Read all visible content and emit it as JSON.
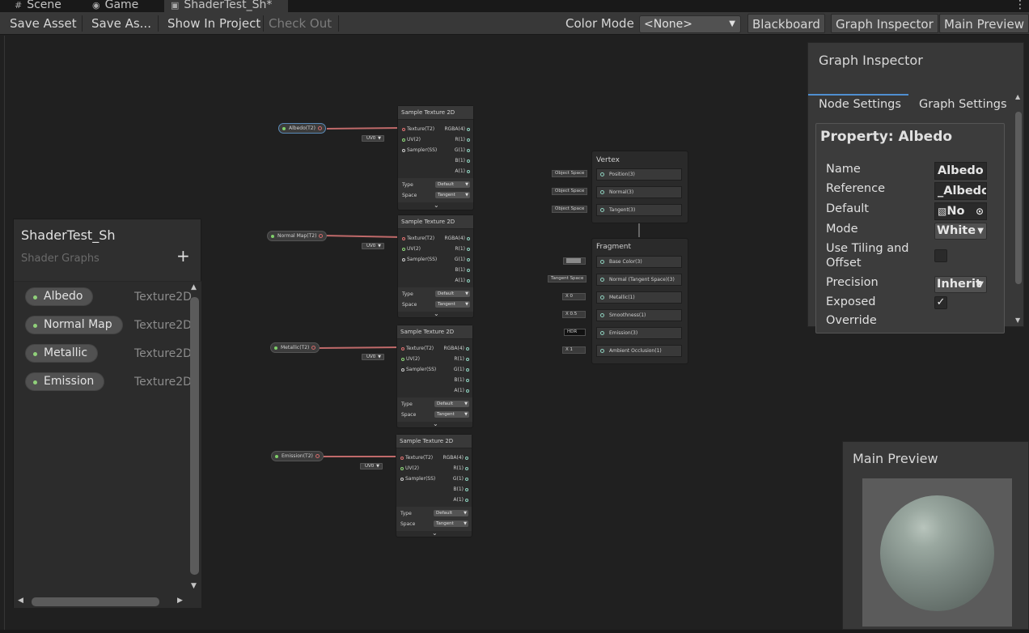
{
  "tabs": [
    {
      "label": "Scene",
      "icon": "grid-icon"
    },
    {
      "label": "Game",
      "icon": "gamepad-icon"
    },
    {
      "label": "ShaderTest_Sh*",
      "icon": "shader-graph-icon"
    }
  ],
  "more_icon": "⋮",
  "toolbar": {
    "save_asset": "Save Asset",
    "save_as": "Save As...",
    "show_in_project": "Show In Project",
    "check_out": "Check Out",
    "color_mode_label": "Color Mode",
    "color_mode_value": "<None>",
    "blackboard": "Blackboard",
    "graph_inspector": "Graph Inspector",
    "main_preview": "Main Preview"
  },
  "graph": {
    "properties": [
      "Albedo(T2)",
      "Normal Map(T2)",
      "Metallic(T2)",
      "Emission(T2)"
    ],
    "sample_texture_nodes": [
      {
        "title": "Sample Texture 2D",
        "uv": "UV0",
        "type": "Default",
        "space": "Tangent"
      },
      {
        "title": "Sample Texture 2D",
        "uv": "UV0",
        "type": "Default",
        "space": "Tangent"
      },
      {
        "title": "Sample Texture 2D",
        "uv": "UV0",
        "type": "Default",
        "space": "Tangent"
      },
      {
        "title": "Sample Texture 2D",
        "uv": "UV0",
        "type": "Default",
        "space": "Tangent"
      }
    ],
    "inputs": [
      "Texture(T2)",
      "UV(2)",
      "Sampler(SS)"
    ],
    "outputs": [
      "RGBA(4)",
      "R(1)",
      "G(1)",
      "B(1)",
      "A(1)"
    ],
    "type_label": "Type",
    "space_label": "Space",
    "vertex": {
      "title": "Vertex",
      "blocks": [
        {
          "label": "Position(3)",
          "input": "Object Space"
        },
        {
          "label": "Normal(3)",
          "input": "Object Space"
        },
        {
          "label": "Tangent(3)",
          "input": "Object Space"
        }
      ]
    },
    "fragment": {
      "title": "Fragment",
      "blocks": [
        {
          "label": "Base Color(3)",
          "input": ""
        },
        {
          "label": "Normal (Tangent Space)(3)",
          "input": "Tangent Space"
        },
        {
          "label": "Metallic(1)",
          "input": "0",
          "prefix": "X"
        },
        {
          "label": "Smoothness(1)",
          "input": "0.5",
          "prefix": "X"
        },
        {
          "label": "Emission(3)",
          "input": "HDR"
        },
        {
          "label": "Ambient Occlusion(1)",
          "input": "1",
          "prefix": "X"
        }
      ]
    }
  },
  "blackboard": {
    "title": "ShaderTest_Sh",
    "subtitle": "Shader Graphs",
    "add": "+",
    "items": [
      {
        "name": "Albedo",
        "type": "Texture2D"
      },
      {
        "name": "Normal Map",
        "type": "Texture2D"
      },
      {
        "name": "Metallic",
        "type": "Texture2D"
      },
      {
        "name": "Emission",
        "type": "Texture2D"
      }
    ]
  },
  "inspector": {
    "title": "Graph Inspector",
    "tab_node": "Node Settings",
    "tab_graph": "Graph Settings",
    "property_title": "Property: Albedo",
    "fields": {
      "name_label": "Name",
      "name_value": "Albedo",
      "reference_label": "Reference",
      "reference_value": "_Albedo",
      "default_label": "Default",
      "default_value": "No",
      "mode_label": "Mode",
      "mode_value": "White",
      "tiling_label": "Use Tiling and Offset",
      "precision_label": "Precision",
      "precision_value": "Inherit",
      "exposed_label": "Exposed",
      "exposed_check": "✓",
      "override_label": "Override"
    }
  },
  "preview": {
    "title": "Main Preview"
  }
}
